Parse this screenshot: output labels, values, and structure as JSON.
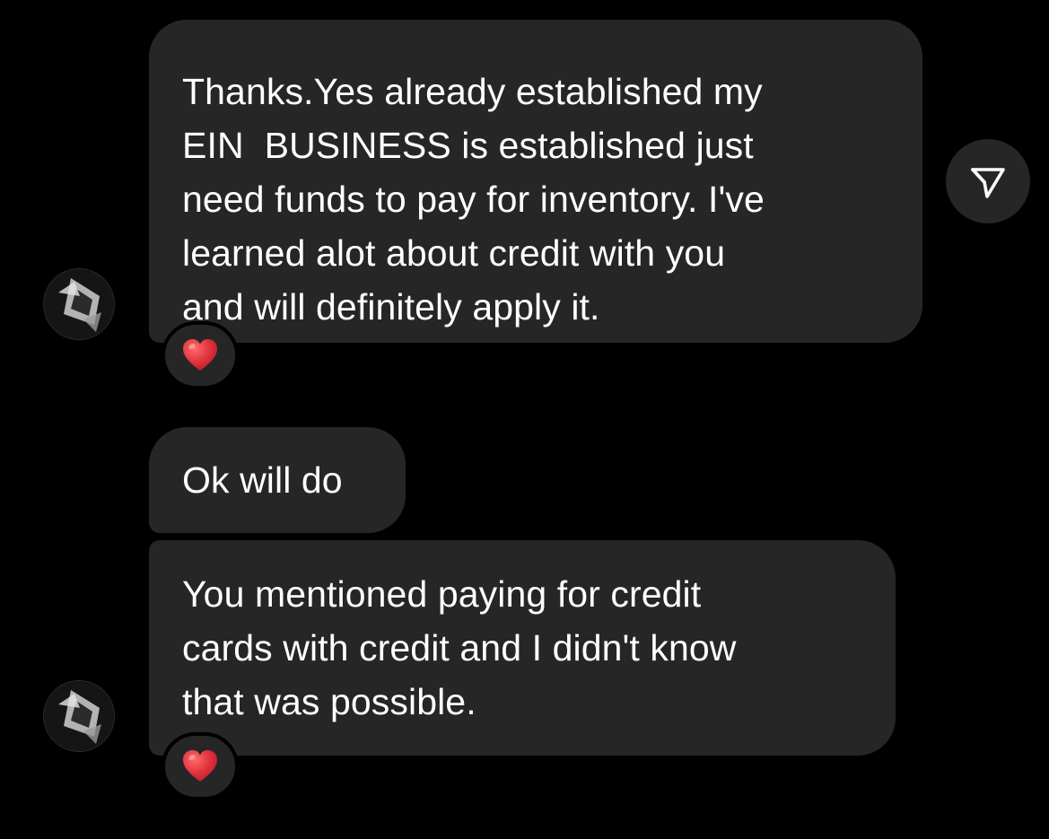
{
  "messages": [
    {
      "lines": [
        "Thanks.Yes already established my",
        "EIN  BUSINESS is established just",
        "need funds to pay for inventory. I've",
        "learned alot about credit with you",
        "and will definitely apply it."
      ],
      "reaction": "heart"
    },
    {
      "lines": [
        "Ok will do"
      ]
    },
    {
      "lines": [
        "You mentioned paying for credit",
        "cards with credit and I didn't know",
        "that was possible."
      ],
      "reaction": "heart"
    }
  ],
  "icons": {
    "share": "paper-plane-icon",
    "reaction": "red-heart-icon",
    "avatar": "sender-avatar"
  },
  "colors": {
    "background": "#000000",
    "bubble": "#262626",
    "text": "#ffffff",
    "heart": "#e0313b"
  }
}
